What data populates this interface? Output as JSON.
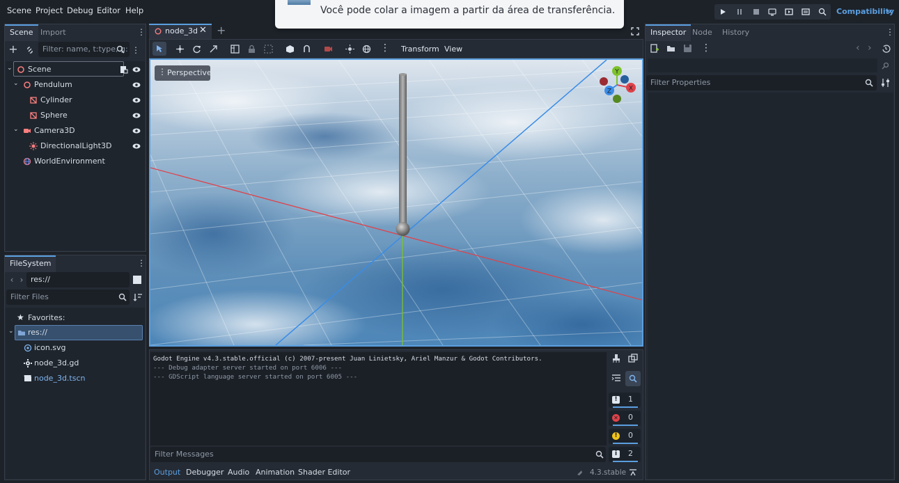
{
  "menu": [
    "Scene",
    "Project",
    "Debug",
    "Editor",
    "Help"
  ],
  "toast": {
    "text": "Você pode colar a imagem a partir da área de transferência."
  },
  "renderer": "Compatibility",
  "scene_dock": {
    "tabs": [
      "Scene",
      "Import"
    ],
    "filter_placeholder": "Filter: name, t:type, g:",
    "tree": [
      {
        "label": "Scene",
        "icon": "node3d-icon",
        "depth": 0
      },
      {
        "label": "Pendulum",
        "icon": "node3d-icon",
        "depth": 1
      },
      {
        "label": "Cylinder",
        "icon": "mesh-instance-icon",
        "depth": 2
      },
      {
        "label": "Sphere",
        "icon": "mesh-instance-icon",
        "depth": 2
      },
      {
        "label": "Camera3D",
        "icon": "camera-icon",
        "depth": 1
      },
      {
        "label": "DirectionalLight3D",
        "icon": "light-icon",
        "depth": 2
      },
      {
        "label": "WorldEnvironment",
        "icon": "globe-icon",
        "depth": 1
      }
    ]
  },
  "filesystem": {
    "tab": "FileSystem",
    "path": "res://",
    "filter_placeholder": "Filter Files",
    "favorites": "Favorites:",
    "items": [
      {
        "label": "res://",
        "icon": "folder-icon"
      },
      {
        "label": "icon.svg",
        "icon": "svg-file-icon"
      },
      {
        "label": "node_3d.gd",
        "icon": "gear-icon"
      },
      {
        "label": "node_3d.tscn",
        "icon": "scene-file-icon"
      }
    ]
  },
  "editor": {
    "scene_tab": "node_3d",
    "toolbar_menus": [
      "Transform",
      "View"
    ],
    "viewport_label": "Perspective",
    "gizmo": {
      "x": "X",
      "y": "Y",
      "z": "Z"
    }
  },
  "output": {
    "lines": [
      "Godot Engine v4.3.stable.official (c) 2007-present Juan Linietsky, Ariel Manzur & Godot Contributors.",
      "--- Debug adapter server started on port 6006 ---",
      "--- GDScript language server started on port 6005 ---"
    ],
    "filter_placeholder": "Filter Messages",
    "counts": {
      "messages": "1",
      "errors": "0",
      "warnings": "0",
      "info": "2"
    },
    "bottom_tabs": [
      "Output",
      "Debugger",
      "Audio",
      "Animation",
      "Shader Editor"
    ],
    "version": "4.3.stable"
  },
  "inspector": {
    "tabs": [
      "Inspector",
      "Node",
      "History"
    ],
    "filter_placeholder": "Filter Properties"
  },
  "colors": {
    "accent": "#5b9fe0",
    "x_axis": "#e0424a",
    "y_axis": "#7ec22c",
    "z_axis": "#3a8ce6",
    "node3d": "#fc7f7f"
  }
}
